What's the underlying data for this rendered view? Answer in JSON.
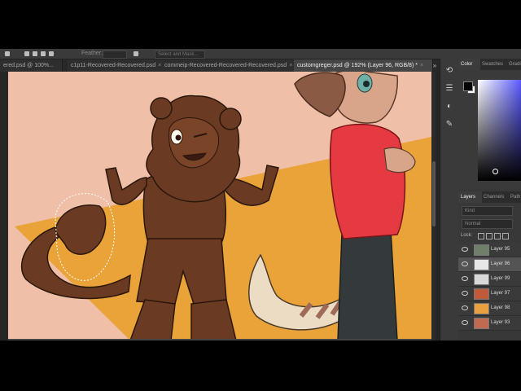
{
  "options_bar": {
    "field_1": "Feather:",
    "field_2": "Select and Mask..."
  },
  "doc_tabs": [
    {
      "label": "ered.psd @ 100%...",
      "active": false
    },
    {
      "label": "c1p11-Recovered-Recovered.psd",
      "active": false
    },
    {
      "label": "commeip-Recovered-Recovered-Recovered.psd",
      "active": false
    },
    {
      "label": "customgreger.psd @ 192% (Layer 96, RGB/8) *",
      "active": true
    }
  ],
  "tabs_more": "»",
  "color_panel": {
    "tabs": [
      "Color",
      "Swatches",
      "Gradie"
    ],
    "foreground": "#000000",
    "background": "#ffffff"
  },
  "layers_panel": {
    "tabs": [
      "Layers",
      "Channels",
      "Path"
    ],
    "search_placeholder": "Kind",
    "blend_mode": "Normal",
    "lock_label": "Lock:",
    "layers": [
      {
        "name": "Layer 95",
        "selected": false,
        "thumb": "#6f7f6a"
      },
      {
        "name": "Layer 96",
        "selected": true,
        "thumb": "#e8e8e8"
      },
      {
        "name": "Layer 99",
        "selected": false,
        "thumb": "#d8d8d8"
      },
      {
        "name": "Layer 97",
        "selected": false,
        "thumb": "#c05a3a"
      },
      {
        "name": "Layer 98",
        "selected": false,
        "thumb": "#e8a040"
      },
      {
        "name": "Layer 93",
        "selected": false,
        "thumb": "#c06a50"
      }
    ]
  },
  "colors": {
    "canvas_bg": "#f0bfa8",
    "orange": "#eaa338",
    "brown": "#6a3b22",
    "red_shirt": "#e63a43",
    "pants": "#343a3b",
    "tail_cream": "#ecdcc3"
  }
}
